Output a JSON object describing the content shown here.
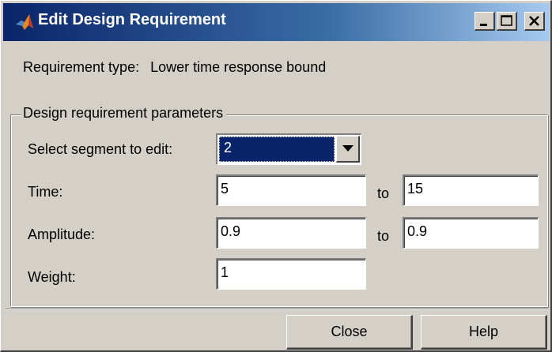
{
  "window": {
    "title": "Edit Design Requirement",
    "icon": "matlab-logo-icon"
  },
  "requirement": {
    "type_label": "Requirement type:",
    "type_value": "Lower time response bound"
  },
  "parameters": {
    "group_label": "Design requirement parameters",
    "segment_label": "Select segment to edit:",
    "segment_value": "2",
    "time_label": "Time:",
    "time_from": "5",
    "time_to": "15",
    "amplitude_label": "Amplitude:",
    "amplitude_from": "0.9",
    "amplitude_to": "0.9",
    "to_label": "to",
    "weight_label": "Weight:",
    "weight_value": "1"
  },
  "buttons": {
    "close_label": "Close",
    "help_label": "Help"
  },
  "colors": {
    "titlebar_start": "#0a246a",
    "titlebar_end": "#a6caf0",
    "face": "#d4d0c8",
    "selection": "#0a246a"
  }
}
